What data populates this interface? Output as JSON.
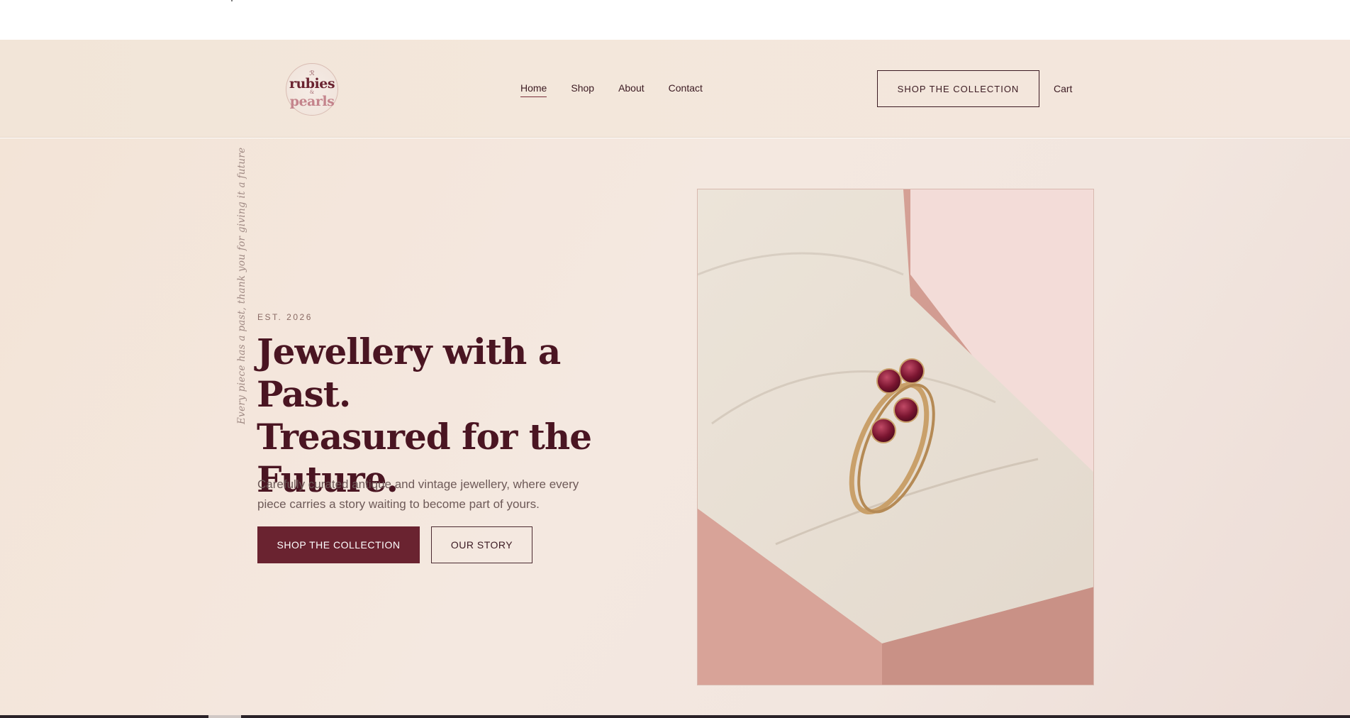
{
  "brand": {
    "logo_top": "ℛ",
    "logo_word1": "rubies",
    "logo_amp": "&",
    "logo_word2": "pearls"
  },
  "nav": {
    "items": [
      {
        "label": "Home",
        "active": true
      },
      {
        "label": "Shop",
        "active": false
      },
      {
        "label": "About",
        "active": false
      },
      {
        "label": "Contact",
        "active": false
      }
    ]
  },
  "header": {
    "cta_label": "SHOP THE COLLECTION",
    "cart_label": "Cart"
  },
  "hero": {
    "vertical_tagline": "Every piece has a past, thank you for giving it a future",
    "eyebrow": "EST. 2026",
    "headline_line1": "Jewellery with a Past.",
    "headline_line2": "Treasured for the",
    "headline_line3": "Future.",
    "description": "Carefully curated antique and vintage jewellery, where every piece carries a story waiting to become part of yours.",
    "primary_button": "SHOP THE COLLECTION",
    "secondary_button": "OUR STORY",
    "image_icon": "ring-in-box-photo"
  },
  "colors": {
    "burgundy": "#6a2330",
    "heading": "#4a1522",
    "background": "#f3e6dc",
    "accent_pink": "#e8c4bc"
  }
}
